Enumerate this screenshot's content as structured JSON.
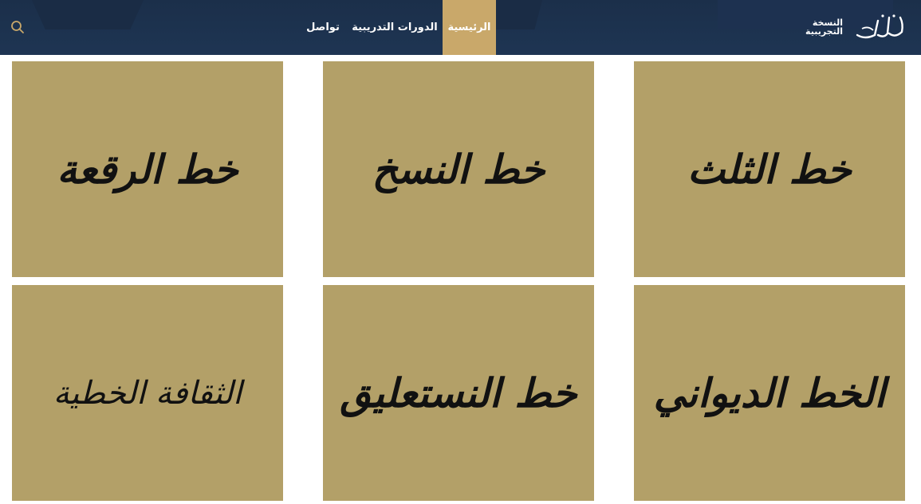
{
  "header": {
    "logo_line1": "النسخة",
    "logo_line2": "التجريبية",
    "nav": [
      {
        "label": "الرئيسية",
        "active": true
      },
      {
        "label": "الدورات التدريبية",
        "active": false
      },
      {
        "label": "تواصل",
        "active": false
      }
    ],
    "search_icon": "search-icon"
  },
  "cards": [
    {
      "title": "خط الثلث"
    },
    {
      "title": "خط النسخ"
    },
    {
      "title": "خط الرقعة"
    },
    {
      "title": "الخط الديواني"
    },
    {
      "title": "خط النستعليق"
    },
    {
      "title": "الثقافة الخطية"
    }
  ],
  "colors": {
    "header_bg": "#1e3553",
    "active_nav": "#c9a86a",
    "card_bg": "#b3a068"
  }
}
